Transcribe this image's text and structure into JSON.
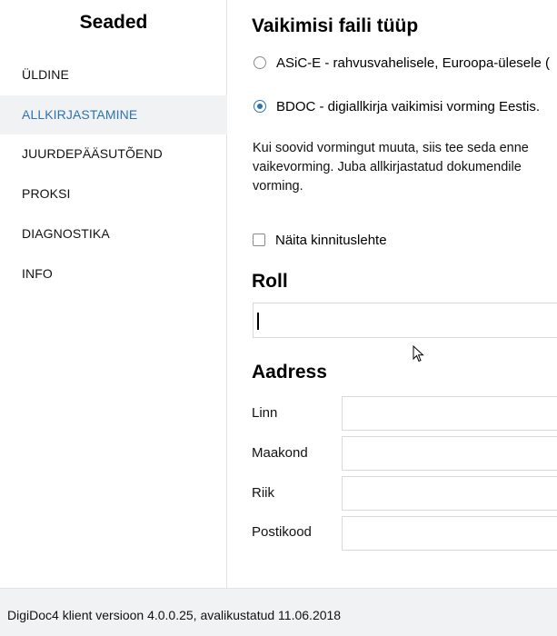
{
  "sidebar": {
    "title": "Seaded",
    "items": [
      {
        "label": "ÜLDINE"
      },
      {
        "label": "ALLKIRJASTAMINE"
      },
      {
        "label": "JUURDEPÄÄSUTÕEND"
      },
      {
        "label": "PROKSI"
      },
      {
        "label": "DIAGNOSTIKA"
      },
      {
        "label": "INFO"
      }
    ],
    "active_item": "ALLKIRJASTAMINE"
  },
  "main": {
    "format_heading": "Vaikimisi faili tüüp",
    "format_options": [
      {
        "label": "ASiC-E - rahvusvahelisele, Euroopa-ülesele (",
        "checked": false
      },
      {
        "label": "BDOC - digiallkirja vaikimisi vorming Eestis.",
        "checked": true
      }
    ],
    "info_lines": [
      "Kui soovid vormingut muuta, siis tee seda enne",
      "vaikevorming. Juba allkirjastatud dokumendile",
      "vorming."
    ],
    "show_confirmation_label": "Näita kinnituslehte",
    "show_confirmation_checked": false,
    "role_heading": "Roll",
    "role_value": "",
    "address_heading": "Aadress",
    "address_fields": [
      {
        "label": "Linn",
        "value": ""
      },
      {
        "label": "Maakond",
        "value": ""
      },
      {
        "label": "Riik",
        "value": ""
      },
      {
        "label": "Postikood",
        "value": ""
      }
    ]
  },
  "footer": {
    "version_text": "DigiDoc4 klient versioon 4.0.0.25, avalikustatud 11.06.2018"
  },
  "colors": {
    "accent": "#2c73b1",
    "active_bg": "#f1f2f4",
    "border": "#d9d9d9"
  }
}
